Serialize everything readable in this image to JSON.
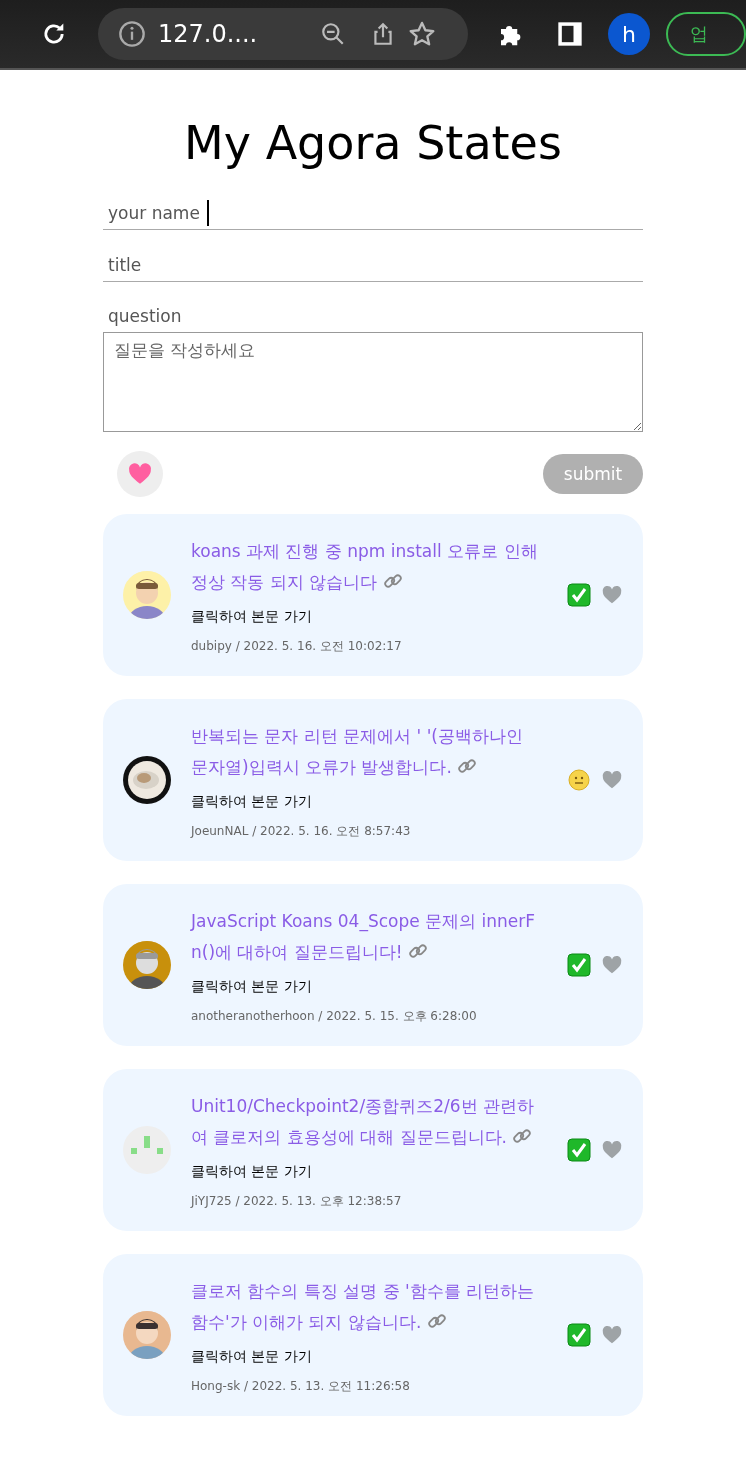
{
  "browser": {
    "url": "127.0....",
    "profile_initial": "h",
    "action_button": "업"
  },
  "page_title": "My Agora States",
  "form": {
    "name_field": {
      "placeholder": "your name",
      "focused": true
    },
    "title_field": {
      "placeholder": "title"
    },
    "question_label": "question",
    "question_field": {
      "placeholder": "질문을 작성하세요"
    },
    "submit_button": "submit"
  },
  "discussions": [
    {
      "title": "koans 과제 진행 중 npm install 오류로 인해 정상 작동 되지 않습니다",
      "body_link": "클릭하여 본문 가기",
      "meta": "dubipy / 2022. 5. 16. 오전 10:02:17",
      "answered": true
    },
    {
      "title": "반복되는 문자 리턴 문제에서 ' '(공백하나인 문자열)입력시 오류가 발생합니다.",
      "body_link": "클릭하여 본문 가기",
      "meta": "JoeunNAL / 2022. 5. 16. 오전 8:57:43",
      "answered": false
    },
    {
      "title": "JavaScript Koans 04_Scope 문제의 innerFn()에 대하여 질문드립니다!",
      "body_link": "클릭하여 본문 가기",
      "meta": "anotheranotherhoon / 2022. 5. 15. 오후 6:28:00",
      "answered": true
    },
    {
      "title": "Unit10/Checkpoint2/종합퀴즈2/6번 관련하여 클로저의 효용성에 대해 질문드립니다.",
      "body_link": "클릭하여 본문 가기",
      "meta": "JiYJ725 / 2022. 5. 13. 오후 12:38:57",
      "answered": true
    },
    {
      "title": "클로저 함수의 특징 설명 중 '함수를 리턴하는 함수'가 이해가 되지 않습니다.",
      "body_link": "클릭하여 본문 가기",
      "meta": "Hong-sk / 2022. 5. 13. 오전 11:26:58",
      "answered": true
    }
  ]
}
